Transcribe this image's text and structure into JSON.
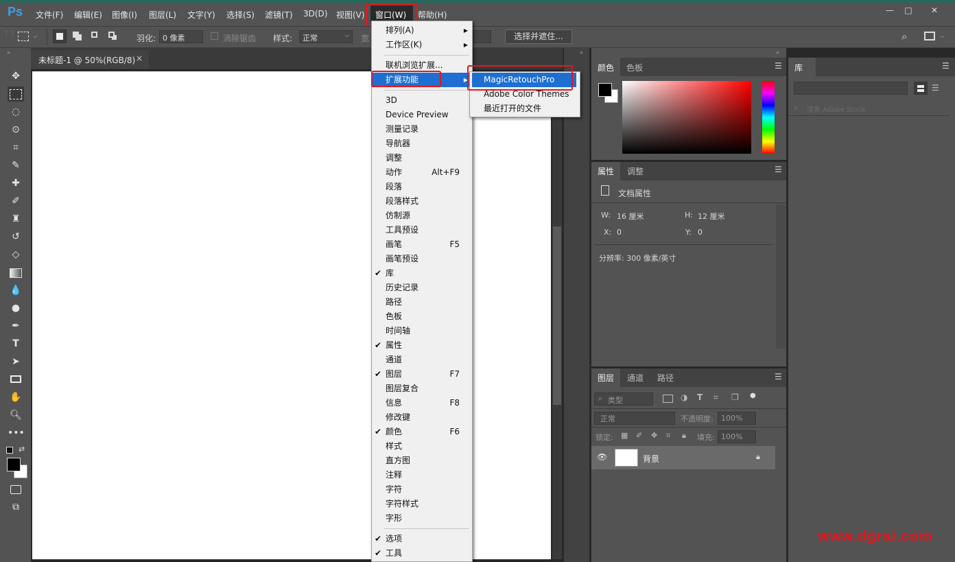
{
  "app": {
    "logo": "Ps"
  },
  "menubar": {
    "items": [
      "文件(F)",
      "编辑(E)",
      "图像(I)",
      "图层(L)",
      "文字(Y)",
      "选择(S)",
      "滤镜(T)",
      "3D(D)",
      "视图(V)",
      "窗口(W)",
      "帮助(H)"
    ],
    "window_controls": [
      "—",
      "□",
      "✕"
    ]
  },
  "options": {
    "feather_label": "羽化:",
    "feather_value": "0 像素",
    "antialias_label": "消除锯齿",
    "style_label": "样式:",
    "style_value": "正常",
    "width_label": "宽",
    "select_mask_button": "选择并遮住..."
  },
  "document": {
    "tab_title": "未标题-1 @ 50%(RGB/8)",
    "tab_close": "×"
  },
  "window_menu": {
    "items": [
      {
        "label": "排列(A)",
        "arrow": "▶"
      },
      {
        "label": "工作区(K)",
        "arrow": "▶"
      },
      {
        "label": "联机浏览扩展..."
      },
      {
        "label": "扩展功能",
        "arrow": "▶"
      },
      {
        "label": "3D"
      },
      {
        "label": "Device Preview"
      },
      {
        "label": "测量记录"
      },
      {
        "label": "导航器"
      },
      {
        "label": "调整"
      },
      {
        "label": "动作",
        "shortcut": "Alt+F9"
      },
      {
        "label": "段落"
      },
      {
        "label": "段落样式"
      },
      {
        "label": "仿制源"
      },
      {
        "label": "工具预设"
      },
      {
        "label": "画笔",
        "shortcut": "F5"
      },
      {
        "label": "画笔预设"
      },
      {
        "label": "库",
        "check": "✔"
      },
      {
        "label": "历史记录"
      },
      {
        "label": "路径"
      },
      {
        "label": "色板"
      },
      {
        "label": "时间轴"
      },
      {
        "label": "属性",
        "check": "✔"
      },
      {
        "label": "通道"
      },
      {
        "label": "图层",
        "check": "✔",
        "shortcut": "F7"
      },
      {
        "label": "图层复合"
      },
      {
        "label": "信息",
        "shortcut": "F8"
      },
      {
        "label": "修改键"
      },
      {
        "label": "颜色",
        "check": "✔",
        "shortcut": "F6"
      },
      {
        "label": "样式"
      },
      {
        "label": "直方图"
      },
      {
        "label": "注释"
      },
      {
        "label": "字符"
      },
      {
        "label": "字符样式"
      },
      {
        "label": "字形"
      },
      {
        "label": "选项",
        "check": "✔"
      },
      {
        "label": "工具",
        "check": "✔"
      }
    ]
  },
  "submenu": {
    "items": [
      "MagicRetouchPro",
      "Adobe Color Themes",
      "最近打开的文件"
    ]
  },
  "color_panel": {
    "tabs": [
      "颜色",
      "色板"
    ]
  },
  "properties_panel": {
    "tabs": [
      "属性",
      "调整"
    ],
    "doc_props": "文档属性",
    "w_label": "W:",
    "w_value": "16 厘米",
    "h_label": "H:",
    "h_value": "12 厘米",
    "x_label": "X:",
    "x_value": "0",
    "y_label": "Y:",
    "y_value": "0",
    "resolution": "分辨率: 300 像素/英寸"
  },
  "layers_panel": {
    "tabs": [
      "图层",
      "通道",
      "路径"
    ],
    "filter_label": "类型",
    "blend_mode": "正常",
    "opacity_label": "不透明度:",
    "opacity_value": "100%",
    "lock_label": "锁定:",
    "fill_label": "填充:",
    "fill_value": "100%",
    "layer_name": "背景"
  },
  "library_panel": {
    "tab": "库",
    "search_placeholder": "搜索 Adobe Stock"
  },
  "watermark": "www.dgrai.com",
  "colors": {
    "accent": "#1e6fd1",
    "highlight_box": "#e8161b",
    "ui_bg": "#535353"
  }
}
